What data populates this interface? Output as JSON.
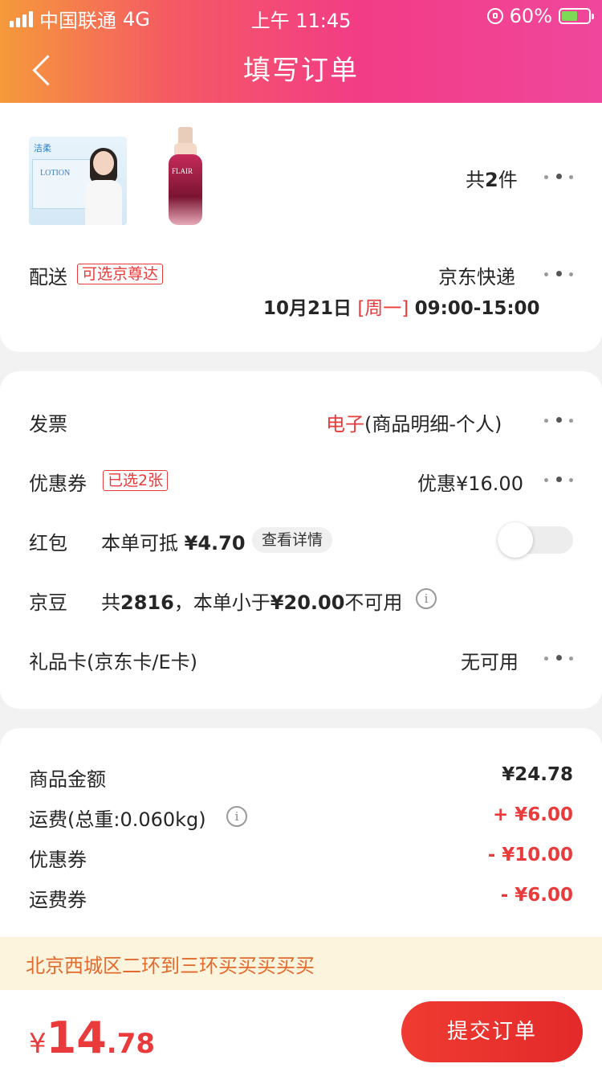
{
  "status_bar": {
    "carrier": "中国联通",
    "network": "4G",
    "time": "上午 11:45",
    "battery": "60%",
    "battery_level": 0.6
  },
  "header": {
    "back_icon": "chevron-left-icon",
    "title": "填写订单"
  },
  "order_items": {
    "count_prefix": "共",
    "count": "2",
    "count_suffix": "件"
  },
  "delivery": {
    "label": "配送",
    "tag": "可选京尊达",
    "method": "京东快递",
    "date": "10月21日",
    "weekday": "[周一]",
    "time_window": "09:00-15:00"
  },
  "invoice": {
    "label": "发票",
    "type": "电子",
    "detail": "(商品明细-个人)"
  },
  "coupon": {
    "label": "优惠券",
    "tag": "已选2张",
    "value": "优惠¥16.00"
  },
  "red_packet": {
    "label": "红包",
    "desc_prefix": "本单可抵",
    "amount": "¥4.70",
    "detail_link": "查看详情",
    "enabled": false
  },
  "jd_beans": {
    "label": "京豆",
    "text_prefix": "共",
    "count": "2816",
    "text_mid": "，本单小于",
    "threshold": "¥20.00",
    "text_suffix": "不可用"
  },
  "gift_card": {
    "label": "礼品卡(京东卡/E卡)",
    "value": "无可用"
  },
  "summary": {
    "goods_label": "商品金额",
    "goods_value": "¥24.78",
    "shipping_label": "运费(总重:0.060kg)",
    "shipping_value": "+ ¥6.00",
    "coupon_label": "优惠券",
    "coupon_value": "- ¥10.00",
    "shipping_coupon_label": "运费券",
    "shipping_coupon_value": "- ¥6.00"
  },
  "address_notice": "北京西城区二环到三环买买买买买",
  "footer": {
    "currency": "¥",
    "total_int": "14",
    "total_dec": ".78",
    "submit_label": "提交订单"
  },
  "colors": {
    "accent_red": "#e93b3b",
    "header_gradient_start": "#f59a3b",
    "header_gradient_end": "#f0479c",
    "notice_bg": "#fcf4dd",
    "notice_text": "#e26a2c"
  }
}
